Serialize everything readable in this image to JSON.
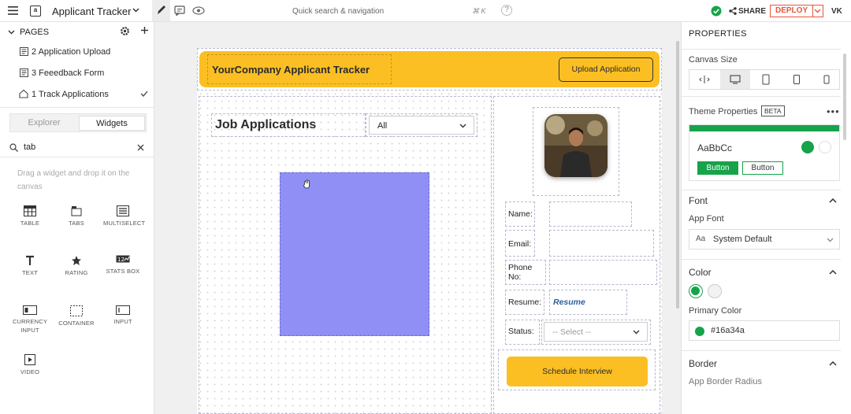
{
  "topbar": {
    "app_title": "Applicant Tracker",
    "search_placeholder": "Quick search & navigation",
    "shortcut": "⌘ K",
    "help": "?",
    "share_label": "SHARE",
    "deploy_label": "DEPLOY",
    "user_initials": "VK"
  },
  "left": {
    "pages_label": "PAGES",
    "pages": [
      {
        "label": "2 Application Upload"
      },
      {
        "label": "3 Feeedback Form"
      },
      {
        "label": "1 Track Applications"
      }
    ],
    "tabs": [
      "Explorer",
      "Widgets"
    ],
    "search_value": "tab",
    "drag_hint": "Drag a widget and drop it on the canvas",
    "widgets": [
      {
        "label": "TABLE"
      },
      {
        "label": "TABS"
      },
      {
        "label": "MULTISELECT"
      },
      {
        "label": "TEXT"
      },
      {
        "label": "RATING"
      },
      {
        "label": "STATS BOX"
      },
      {
        "label": "CURRENCY INPUT"
      },
      {
        "label": "CONTAINER"
      },
      {
        "label": "INPUT"
      },
      {
        "label": "VIDEO"
      }
    ]
  },
  "canvas": {
    "header_title": "YourCompany Applicant Tracker",
    "upload_button": "Upload Application",
    "job_title": "Job Applications",
    "filter_value": "All",
    "form": {
      "name_label": "Name:",
      "email_label": "Email:",
      "phone_label": "Phone No:",
      "resume_label": "Resume:",
      "resume_link": "Resume",
      "status_label": "Status:",
      "status_placeholder": "-- Select --",
      "schedule_button": "Schedule Interview"
    }
  },
  "right": {
    "properties_label": "PROPERTIES",
    "canvas_size_label": "Canvas Size",
    "theme_label": "Theme Properties",
    "beta_label": "BETA",
    "theme_sample": "AaBbCc",
    "theme_btn_primary": "Button",
    "theme_btn_secondary": "Button",
    "font_title": "Font",
    "app_font_label": "App Font",
    "font_icon_text": "Aa",
    "font_value": "System Default",
    "color_title": "Color",
    "primary_color_label": "Primary Color",
    "primary_color_value": "#16a34a",
    "border_title": "Border",
    "border_radius_label": "App Border Radius"
  },
  "colors": {
    "accent_green": "#16a34a",
    "banner_yellow": "#fbbf24",
    "selection_blue": "#8f8ff5",
    "deploy_red": "#e8563b"
  }
}
